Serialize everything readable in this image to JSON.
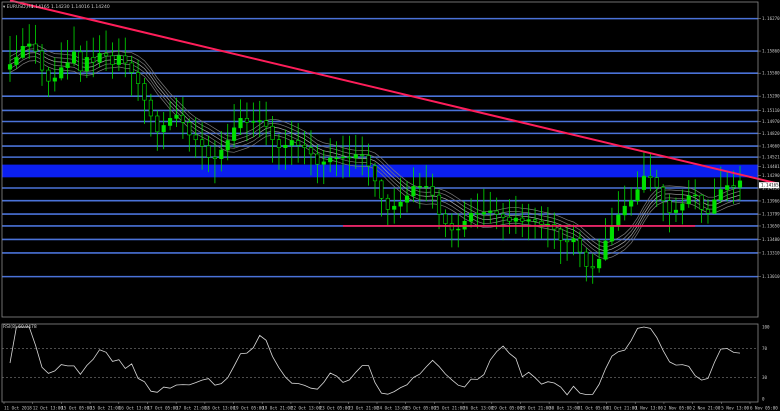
{
  "chart_data": {
    "type": "candlestick",
    "main_title": "▾ EURUSD,H4",
    "main_values": "1.14165 1.14230 1.14016 1.14240",
    "indicator_title": "RSI(8) 60.9478",
    "ylim": [
      1.125,
      1.1648
    ],
    "y_ticks": [
      "1.16270",
      "1.15860",
      "1.15580",
      "1.15290",
      "1.15110",
      "1.14970",
      "1.14820",
      "1.14660",
      "1.14521",
      "1.14401",
      "1.14290",
      "1.14130",
      "1.13966",
      "1.13799",
      "1.13650",
      "1.13480",
      "1.13310",
      "1.13010"
    ],
    "price_label": "1.14165",
    "rsi_ylim": [
      0,
      100
    ],
    "rsi_ticks": [
      "100",
      "70",
      "30",
      "0"
    ],
    "x_labels": [
      "11 Oct 2018",
      "12 Oct 13:00",
      "15 Oct 05:00",
      "15 Oct 21:00",
      "16 Oct 13:00",
      "17 Oct 05:00",
      "17 Oct 21:00",
      "18 Oct 13:00",
      "19 Oct 05:00",
      "19 Oct 21:00",
      "22 Oct 13:00",
      "23 Oct 05:00",
      "23 Oct 21:00",
      "24 Oct 13:00",
      "25 Oct 05:00",
      "25 Oct 21:00",
      "26 Oct 13:00",
      "29 Oct 05:00",
      "29 Oct 21:00",
      "30 Oct 13:00",
      "31 Oct 05:00",
      "31 Oct 21:00",
      "1 Nov 13:00",
      "2 Nov 05:00",
      "2 Nov 21:00",
      "5 Nov 13:00",
      "6 Nov 05:00"
    ],
    "close": [
      1.1569,
      1.1578,
      1.1592,
      1.1595,
      1.1586,
      1.1562,
      1.1548,
      1.1552,
      1.1565,
      1.1571,
      1.1585,
      1.1561,
      1.1578,
      1.1572,
      1.1583,
      1.158,
      1.1569,
      1.158,
      1.1571,
      1.1559,
      1.1545,
      1.1524,
      1.1504,
      1.1484,
      1.1492,
      1.1501,
      1.1505,
      1.1496,
      1.148,
      1.1474,
      1.1466,
      1.1452,
      1.145,
      1.1461,
      1.1473,
      1.1489,
      1.1501,
      1.1496,
      1.1497,
      1.1498,
      1.1491,
      1.1474,
      1.1464,
      1.1467,
      1.1473,
      1.1467,
      1.1464,
      1.1456,
      1.1443,
      1.1446,
      1.1451,
      1.1451,
      1.1452,
      1.1451,
      1.1455,
      1.1454,
      1.1441,
      1.1422,
      1.14,
      1.1386,
      1.139,
      1.1395,
      1.1403,
      1.1415,
      1.1415,
      1.1415,
      1.1404,
      1.138,
      1.1368,
      1.136,
      1.1361,
      1.1371,
      1.1381,
      1.138,
      1.1382,
      1.1384,
      1.138,
      1.1376,
      1.1371,
      1.1375,
      1.1371,
      1.1373,
      1.1371,
      1.1367,
      1.1367,
      1.1361,
      1.1347,
      1.1345,
      1.1349,
      1.1332,
      1.1314,
      1.1312,
      1.1323,
      1.1346,
      1.1365,
      1.1379,
      1.139,
      1.1397,
      1.1411,
      1.1428,
      1.1426,
      1.1414,
      1.1397,
      1.1382,
      1.1385,
      1.1393,
      1.1403,
      1.1404,
      1.1386,
      1.1381,
      1.1398,
      1.1411,
      1.1416,
      1.1414,
      1.1422
    ],
    "high": [
      1.1605,
      1.1606,
      1.1615,
      1.162,
      1.1619,
      1.1595,
      1.1566,
      1.1578,
      1.1597,
      1.16,
      1.1617,
      1.1593,
      1.1599,
      1.1603,
      1.1606,
      1.1612,
      1.1597,
      1.1602,
      1.1603,
      1.158,
      1.1575,
      1.1552,
      1.1532,
      1.1511,
      1.1509,
      1.1523,
      1.1527,
      1.1528,
      1.1501,
      1.1502,
      1.1496,
      1.1479,
      1.1473,
      1.1485,
      1.1494,
      1.1519,
      1.1525,
      1.1521,
      1.1521,
      1.1523,
      1.1522,
      1.1504,
      1.1481,
      1.1487,
      1.1498,
      1.1495,
      1.1485,
      1.1486,
      1.1468,
      1.1461,
      1.1476,
      1.1472,
      1.1479,
      1.1479,
      1.148,
      1.1478,
      1.1469,
      1.1445,
      1.1424,
      1.1405,
      1.1413,
      1.1426,
      1.1422,
      1.1439,
      1.1432,
      1.1442,
      1.1431,
      1.1411,
      1.1386,
      1.1381,
      1.1381,
      1.1396,
      1.14,
      1.1406,
      1.1412,
      1.1408,
      1.1401,
      1.1394,
      1.1399,
      1.1403,
      1.1393,
      1.1393,
      1.1388,
      1.139,
      1.1389,
      1.1382,
      1.1366,
      1.1367,
      1.1367,
      1.1358,
      1.1337,
      1.133,
      1.1349,
      1.1375,
      1.1388,
      1.1409,
      1.1416,
      1.1414,
      1.1434,
      1.1459,
      1.1458,
      1.1436,
      1.1418,
      1.1405,
      1.1401,
      1.1411,
      1.1423,
      1.1424,
      1.1405,
      1.1399,
      1.1425,
      1.144,
      1.1435,
      1.1435,
      1.1441
    ],
    "low": [
      1.1547,
      1.1564,
      1.1576,
      1.1576,
      1.157,
      1.1542,
      1.1528,
      1.1535,
      1.1549,
      1.155,
      1.1567,
      1.1547,
      1.1552,
      1.1553,
      1.1565,
      1.1561,
      1.1551,
      1.1561,
      1.1553,
      1.1529,
      1.1523,
      1.1494,
      1.1478,
      1.146,
      1.1462,
      1.1486,
      1.149,
      1.1475,
      1.1459,
      1.1451,
      1.1436,
      1.1433,
      1.1419,
      1.1434,
      1.1448,
      1.1464,
      1.148,
      1.1472,
      1.1477,
      1.1477,
      1.1467,
      1.1445,
      1.1436,
      1.1436,
      1.1442,
      1.1445,
      1.1443,
      1.1429,
      1.1419,
      1.1418,
      1.1433,
      1.1428,
      1.1425,
      1.1427,
      1.1437,
      1.1429,
      1.1416,
      1.1402,
      1.1377,
      1.1366,
      1.1368,
      1.1375,
      1.1382,
      1.1395,
      1.1387,
      1.1396,
      1.1387,
      1.1361,
      1.1351,
      1.1338,
      1.1338,
      1.1351,
      1.1363,
      1.1362,
      1.1366,
      1.1368,
      1.1361,
      1.1347,
      1.1355,
      1.1355,
      1.1351,
      1.1347,
      1.1349,
      1.1349,
      1.1338,
      1.1336,
      1.1317,
      1.1321,
      1.1328,
      1.1313,
      1.1295,
      1.1292,
      1.1306,
      1.1321,
      1.1341,
      1.1359,
      1.1372,
      1.1378,
      1.1392,
      1.1407,
      1.1409,
      1.1389,
      1.1371,
      1.1357,
      1.137,
      1.1367,
      1.1388,
      1.1386,
      1.1369,
      1.1368,
      1.138,
      1.1394,
      1.1396,
      1.1393,
      1.1397
    ],
    "horizontal_levels": [
      1.1627,
      1.1586,
      1.1558,
      1.1529,
      1.1511,
      1.1497,
      1.1482,
      1.1466,
      1.1452,
      1.144,
      1.1429,
      1.1413,
      1.1397,
      1.138,
      1.1365,
      1.1348,
      1.1331,
      1.1301
    ],
    "blue_zone": [
      1.1429,
      1.144
    ],
    "trendline": {
      "from": [
        0,
        1.165
      ],
      "to": [
        114,
        1.143
      ]
    },
    "support_line": {
      "from": [
        52,
        1.1365
      ],
      "to": [
        107,
        1.1365
      ]
    },
    "rsi_levels": [
      70,
      30
    ]
  }
}
